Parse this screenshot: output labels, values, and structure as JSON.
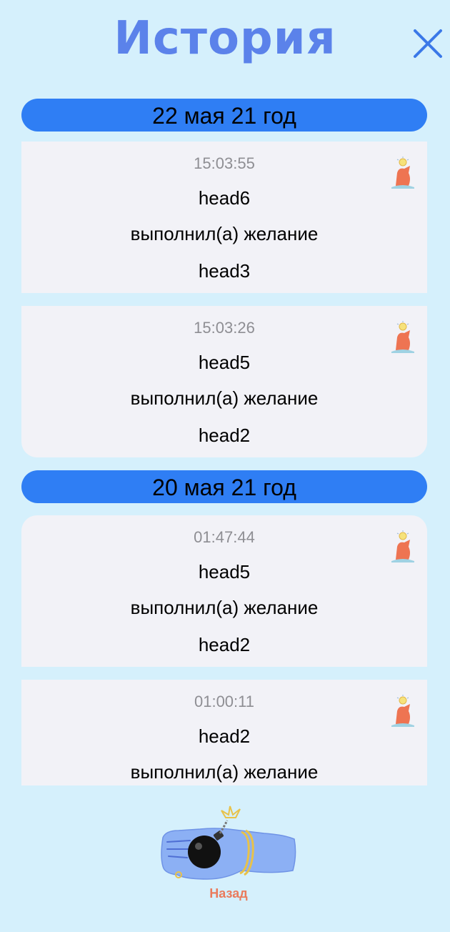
{
  "header": {
    "title": "История",
    "close_icon": "close-icon"
  },
  "groups": [
    {
      "date": "22 мая 21 год",
      "entries": [
        {
          "time": "15:03:55",
          "from": "head6",
          "action": "выполнил(а) желание",
          "to": "head3",
          "icon": "mascot-icon"
        },
        {
          "time": "15:03:26",
          "from": "head5",
          "action": "выполнил(а) желание",
          "to": "head2",
          "icon": "mascot-icon"
        }
      ]
    },
    {
      "date": "20 мая 21 год",
      "entries": [
        {
          "time": "01:47:44",
          "from": "head5",
          "action": "выполнил(а) желание",
          "to": "head2",
          "icon": "mascot-icon"
        },
        {
          "time": "01:00:11",
          "from": "head2",
          "action": "выполнил(а) желание",
          "to": "",
          "icon": "mascot-icon"
        }
      ]
    }
  ],
  "footer": {
    "back_label": "Назад",
    "back_icon": "bomb-hand-icon"
  },
  "colors": {
    "background": "#d5f0fc",
    "accent": "#2f7ef4",
    "title": "#5b82ea",
    "card": "#f2f2f7",
    "back_label": "#ea7b5c"
  }
}
